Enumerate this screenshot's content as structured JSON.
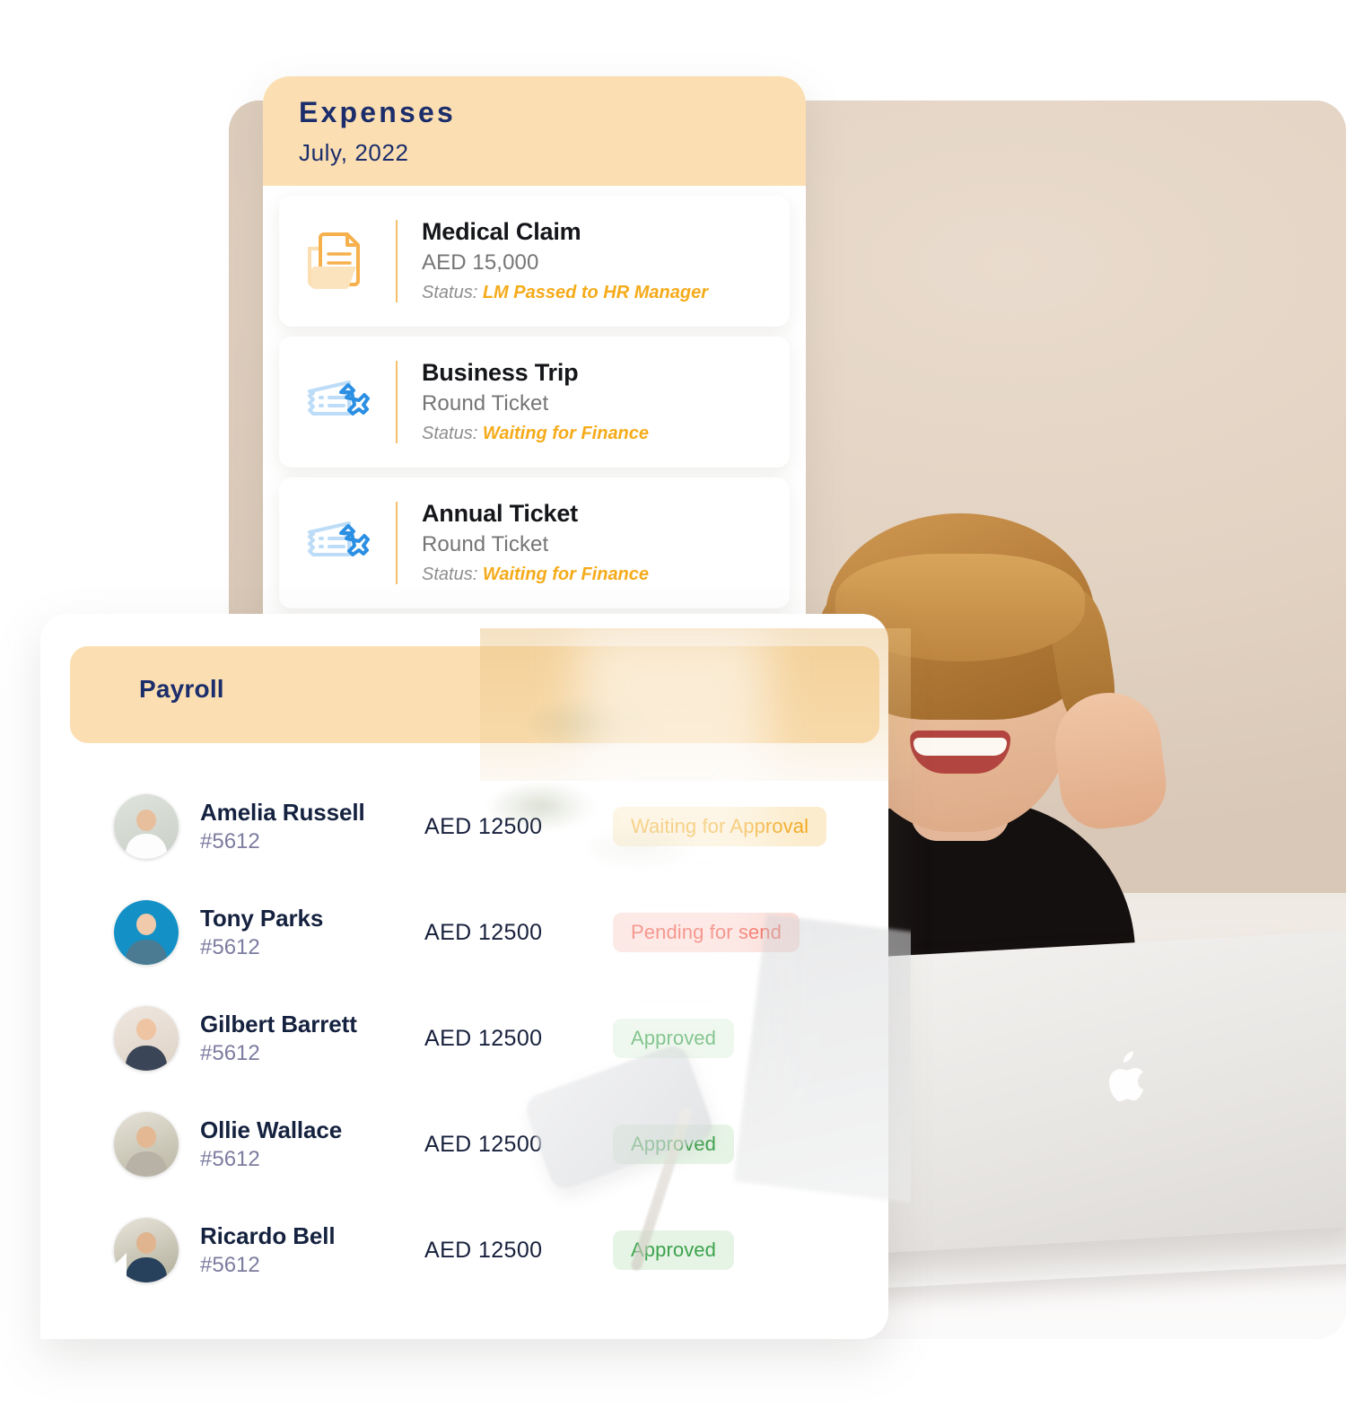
{
  "expenses": {
    "title": "Expenses",
    "subtitle": "July, 2022",
    "status_label": "Status:",
    "items": [
      {
        "icon": "document-folder-icon",
        "name": "Medical Claim",
        "detail": "AED 15,000",
        "status": "LM Passed to HR Manager"
      },
      {
        "icon": "flight-ticket-icon",
        "name": "Business Trip",
        "detail": "Round Ticket",
        "status": "Waiting for Finance"
      },
      {
        "icon": "flight-ticket-icon",
        "name": "Annual Ticket",
        "detail": "Round Ticket",
        "status": "Waiting for Finance"
      }
    ]
  },
  "payroll": {
    "title": "Payroll",
    "rows": [
      {
        "name": "Amelia Russell",
        "id": "#5612",
        "amount": "AED 12500",
        "status": "Waiting for Approval",
        "status_kind": "waiting",
        "avatar": "avatar-amelia-russell"
      },
      {
        "name": "Tony Parks",
        "id": "#5612",
        "amount": "AED 12500",
        "status": "Pending for send",
        "status_kind": "pending",
        "avatar": "avatar-tony-parks"
      },
      {
        "name": "Gilbert Barrett",
        "id": "#5612",
        "amount": "AED 12500",
        "status": "Approved",
        "status_kind": "approved",
        "avatar": "avatar-gilbert-barrett"
      },
      {
        "name": "Ollie Wallace",
        "id": "#5612",
        "amount": "AED 12500",
        "status": "Approved",
        "status_kind": "approved",
        "avatar": "avatar-ollie-wallace"
      },
      {
        "name": "Ricardo Bell",
        "id": "#5612",
        "amount": "AED 12500",
        "status": "Approved",
        "status_kind": "approved",
        "avatar": "avatar-ricardo-bell"
      }
    ]
  },
  "background": {
    "photo": "smiling-woman-with-glasses-and-laptop"
  },
  "colors": {
    "header_band": "#FBDFB2",
    "navy_text": "#1B2D6B",
    "status_amber": "#F5AB1A",
    "badge_waiting_bg": "#FBECCD",
    "badge_waiting_text": "#F0A81D",
    "badge_pending_bg": "#FBDAD5",
    "badge_pending_text": "#EF4C3C",
    "badge_approved_bg": "#E6F4E6",
    "badge_approved_text": "#3DA34D",
    "divider_orange": "#F0AB3A",
    "ticket_blue": "#2B8FE3",
    "doc_orange": "#F6B04C"
  }
}
